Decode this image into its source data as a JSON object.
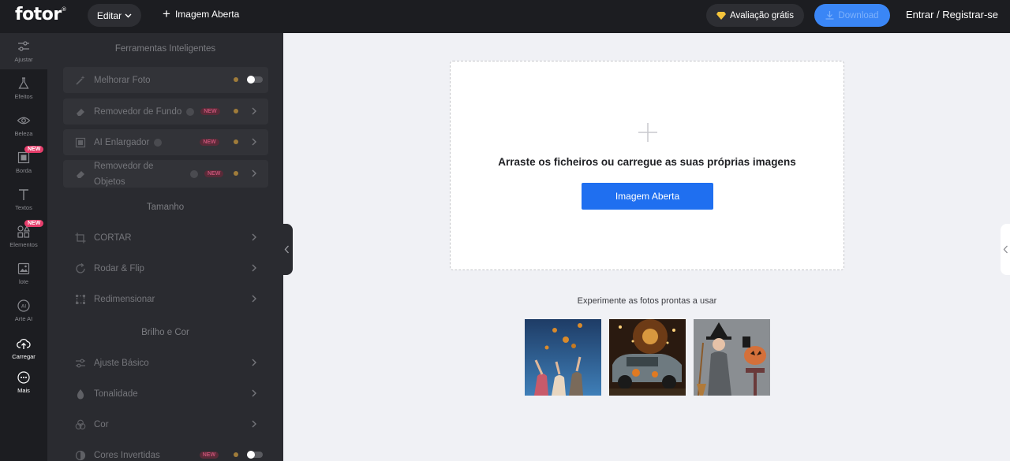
{
  "topbar": {
    "logo": "fotor",
    "logo_mark": "®",
    "edit_label": "Editar",
    "open_image_label": "Imagem Aberta",
    "trial_label": "Avaliação grátis",
    "download_label": "Download",
    "login_label": "Entrar / Registrar-se"
  },
  "rail": {
    "new_badge": "NEW",
    "items": [
      {
        "label": "Ajustar",
        "icon": "sliders-icon"
      },
      {
        "label": "Efeitos",
        "icon": "flask-icon"
      },
      {
        "label": "Beleza",
        "icon": "eye-icon"
      },
      {
        "label": "Borda",
        "icon": "frame-icon"
      },
      {
        "label": "Textos",
        "icon": "text-icon"
      },
      {
        "label": "Elementos",
        "icon": "shapes-icon"
      },
      {
        "label": "lote",
        "icon": "batch-icon"
      },
      {
        "label": "Arte AI",
        "icon": "ai-icon"
      },
      {
        "label": "Carregar",
        "icon": "cloud-upload-icon"
      },
      {
        "label": "Mais",
        "icon": "more-icon"
      }
    ]
  },
  "panel": {
    "sections": {
      "smart": "Ferramentas Inteligentes",
      "size": "Tamanho",
      "color": "Brilho e Cor"
    },
    "new_badge": "NEW",
    "tools": {
      "enhance": "Melhorar Foto",
      "bg_remover": "Removedor de Fundo",
      "enlarger": "AI Enlargador",
      "obj_remover": "Removedor de Objetos",
      "crop": "CORTAR",
      "rotate": "Rodar & Flip",
      "resize": "Redimensionar",
      "basic": "Ajuste Básico",
      "tone": "Tonalidade",
      "color": "Cor",
      "invert": "Cores Invertidas"
    }
  },
  "main": {
    "drop_text": "Arraste os ficheiros ou carregue as suas próprias imagens",
    "open_button": "Imagem Aberta",
    "samples_title": "Experimente as fotos prontas a usar"
  },
  "colors": {
    "accent": "#1f6ff0",
    "new_badge": "#e63d6b",
    "dark_bg": "#1c1d21",
    "panel_bg": "#2a2b30"
  }
}
